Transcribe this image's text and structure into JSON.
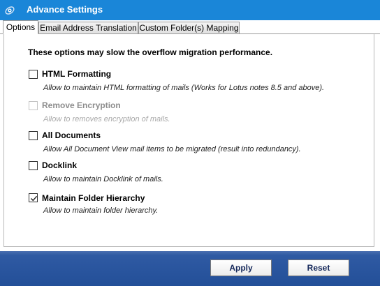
{
  "window": {
    "title": "Advance Settings",
    "accent_color": "#1a86d8",
    "footer_color": "#234f98"
  },
  "tabs": [
    {
      "label": "Options",
      "active": true
    },
    {
      "label": "Email Address Translation",
      "active": false
    },
    {
      "label": "Custom Folder(s) Mapping",
      "active": false
    }
  ],
  "panel": {
    "warning": "These options may slow the overflow migration performance.",
    "options": [
      {
        "label": "HTML Formatting",
        "description": "Allow to maintain HTML formatting of mails (Works for Lotus notes 8.5 and above).",
        "checked": false,
        "enabled": true
      },
      {
        "label": "Remove Encryption",
        "description": "Allow to removes encryption of mails.",
        "checked": false,
        "enabled": false
      },
      {
        "label": "All Documents",
        "description": "Allow All Document View mail items to be migrated (result into redundancy).",
        "checked": false,
        "enabled": true
      },
      {
        "label": "Docklink",
        "description": "Allow to maintain Docklink of mails.",
        "checked": false,
        "enabled": true
      },
      {
        "label": "Maintain Folder Hierarchy",
        "description": "Allow to maintain folder hierarchy.",
        "checked": true,
        "enabled": true
      }
    ]
  },
  "buttons": {
    "apply": "Apply",
    "reset": "Reset"
  }
}
